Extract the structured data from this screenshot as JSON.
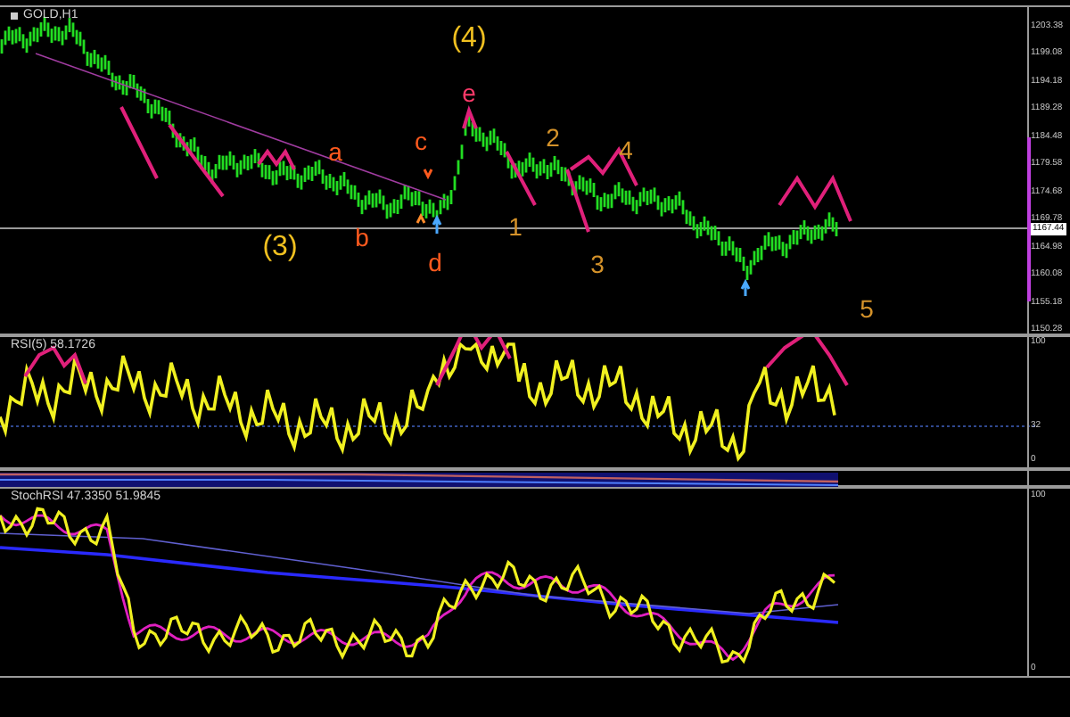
{
  "chart": {
    "symbol": "GOLD,H1"
  },
  "price_axis": {
    "ticks": [
      "1203.38",
      "1199.08",
      "1194.18",
      "1189.28",
      "1184.48",
      "1179.58",
      "1174.68",
      "1169.78",
      "1164.98",
      "1160.08",
      "1155.18",
      "1150.28"
    ],
    "current_price": "1167.44"
  },
  "wave_labels": [
    {
      "text": "(4)",
      "color": "#f0c020"
    },
    {
      "text": "e",
      "color": "#ff3a6a"
    },
    {
      "text": "c",
      "color": "#ff5a1e"
    },
    {
      "text": "2",
      "color": "#d4922a"
    },
    {
      "text": "a",
      "color": "#ff5a1e"
    },
    {
      "text": "4",
      "color": "#d4922a"
    },
    {
      "text": "(3)",
      "color": "#f0c020"
    },
    {
      "text": "b",
      "color": "#ff5a1e"
    },
    {
      "text": "1",
      "color": "#d4922a"
    },
    {
      "text": "d",
      "color": "#ff5a1e"
    },
    {
      "text": "3",
      "color": "#d4922a"
    },
    {
      "text": "5",
      "color": "#d4922a"
    }
  ],
  "rsi_panel": {
    "title": "RSI(5) 58.1726",
    "ticks": [
      "100",
      "32",
      "0"
    ]
  },
  "stoch_panel": {
    "title": "StochRSI 47.3350 51.9845",
    "ticks": [
      "100",
      "0"
    ]
  }
}
